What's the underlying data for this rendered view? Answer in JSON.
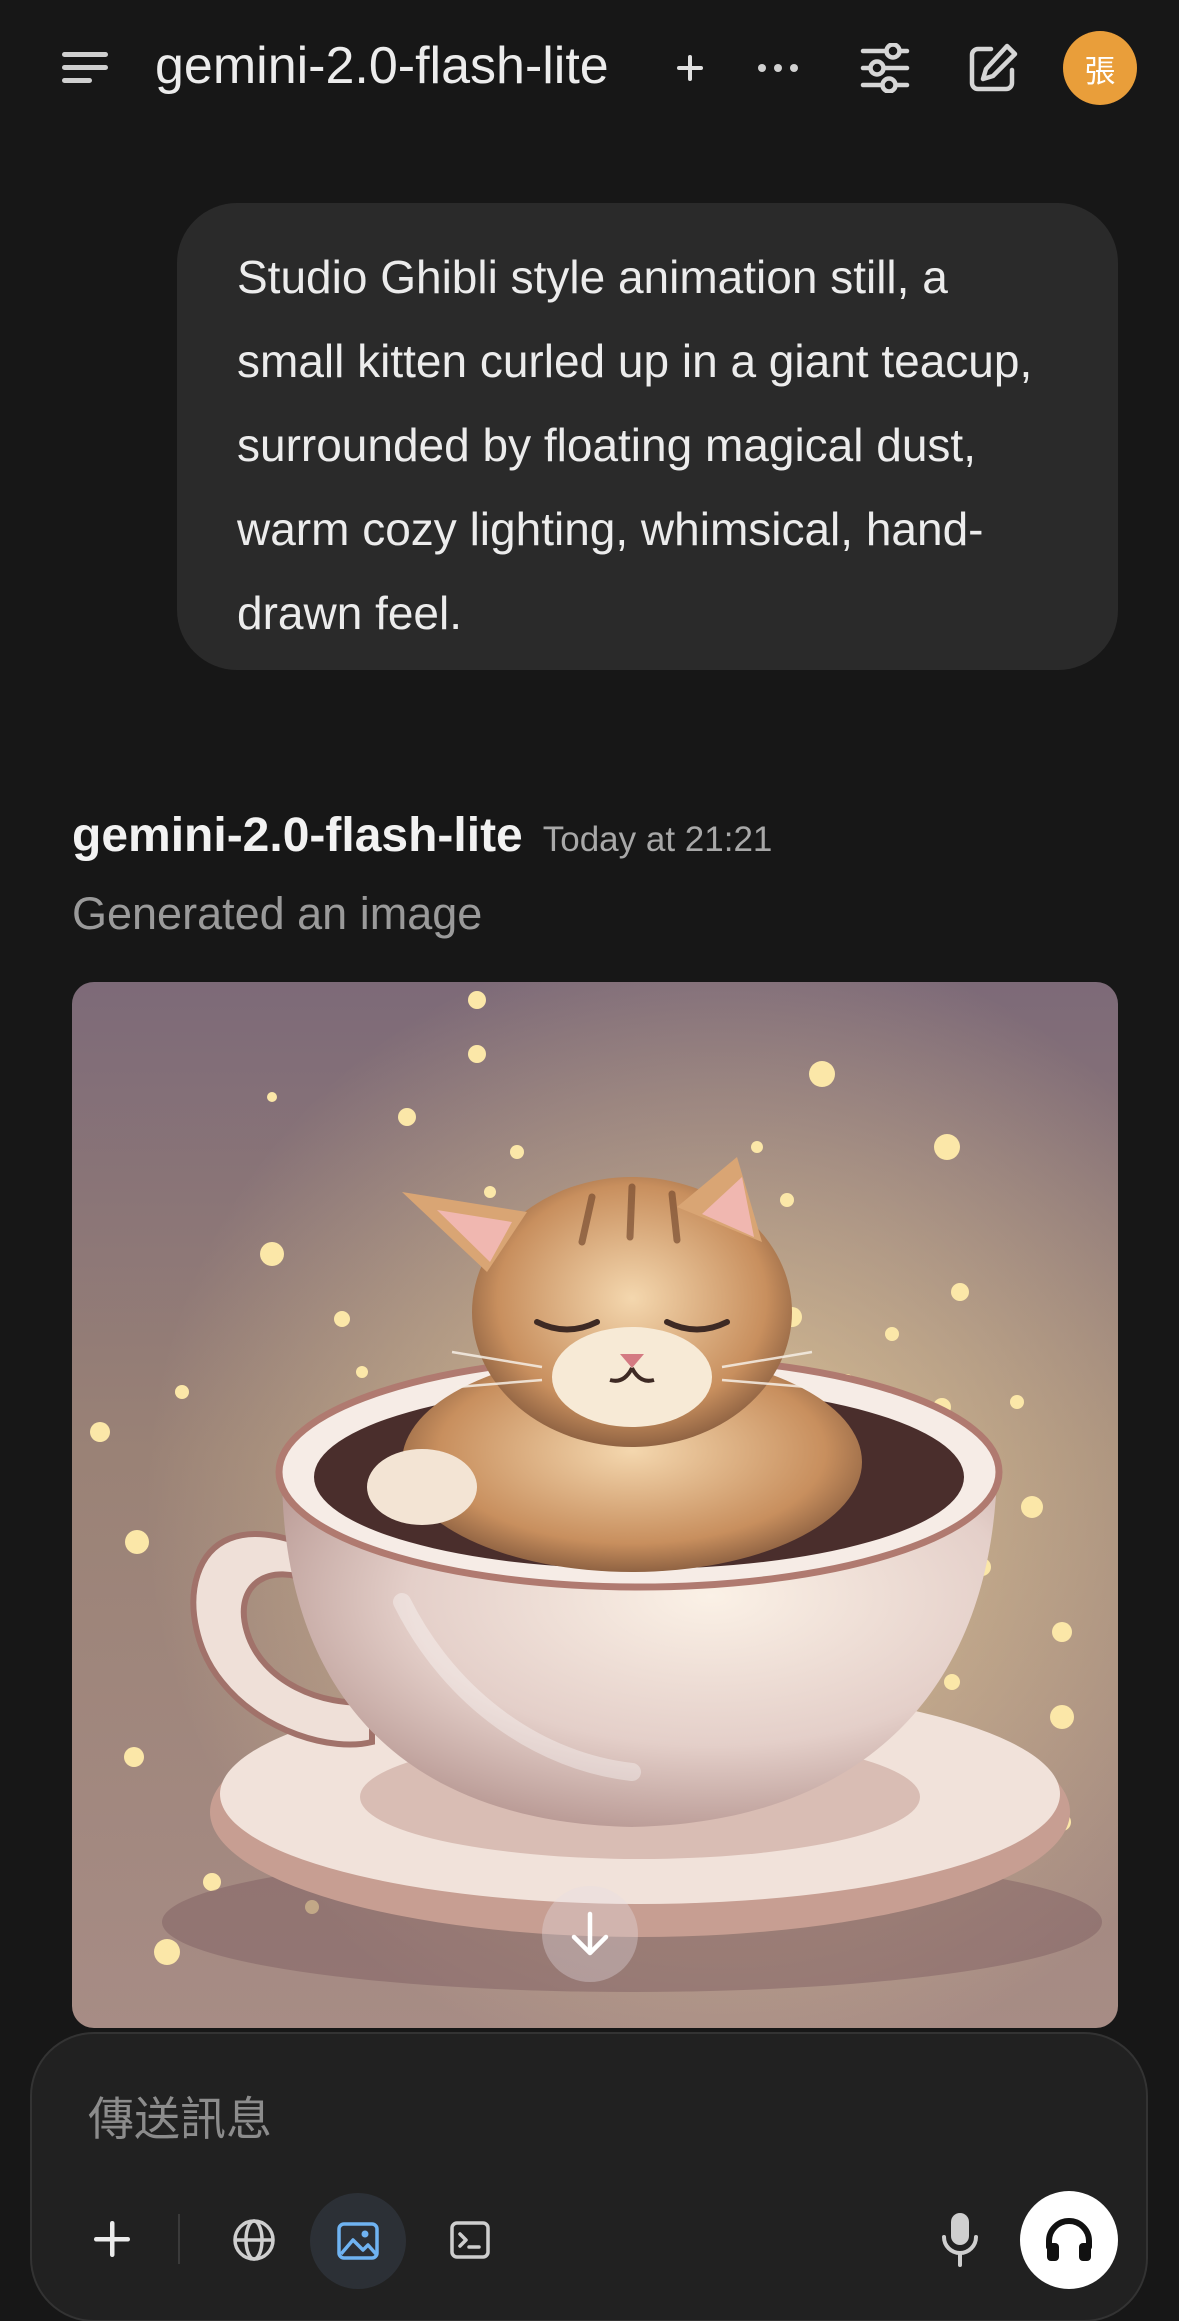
{
  "header": {
    "model_name": "gemini-2.0-flash-lite",
    "avatar_initial": "張"
  },
  "user_message": {
    "text": "Studio Ghibli style animation still, a small kitten curled up in a giant teacup, surrounded by floating magical dust, warm cozy lighting, whimsical, hand-drawn feel."
  },
  "assistant_message": {
    "model_name": "gemini-2.0-flash-lite",
    "timestamp": "Today at 21:21",
    "status": "Generated an image"
  },
  "composer": {
    "placeholder": "傳送訊息"
  },
  "colors": {
    "background": "#171717",
    "bubble": "#2a2a2a",
    "avatar": "#e99e3a",
    "image_tool_active": "#6fb3f2"
  },
  "icons": {
    "menu": "menu-icon",
    "new_chat": "plus-icon",
    "more": "more-icon",
    "controls": "sliders-icon",
    "edit": "edit-icon",
    "download": "download-icon",
    "attach": "plus-icon",
    "web_search": "globe-icon",
    "image_generation": "image-icon",
    "code_interpreter": "terminal-icon",
    "dictate": "microphone-icon",
    "voice_mode": "headphones-icon"
  }
}
